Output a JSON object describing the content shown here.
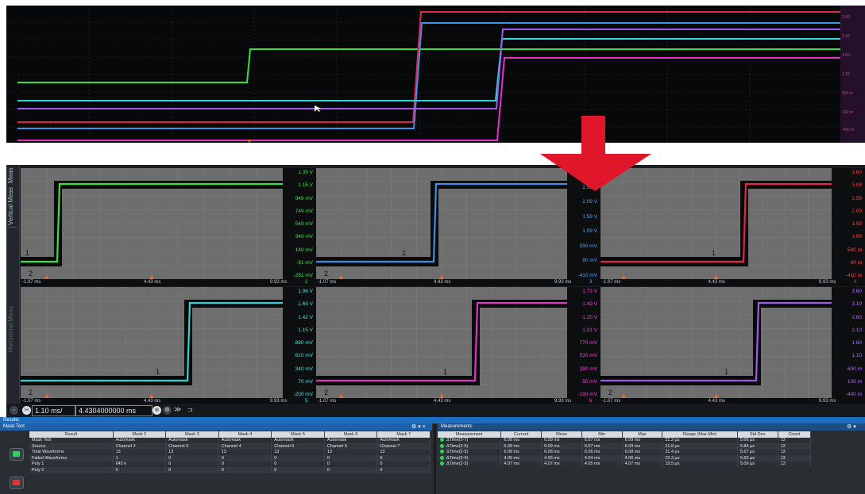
{
  "overview": {
    "scale_labels": [
      "2.60",
      "2.10",
      "1.60",
      "1.10",
      "600 m",
      "100 m",
      "-400 m"
    ]
  },
  "panels": [
    {
      "ticks": [
        "1.35 V",
        "1.15 V",
        "949 mV",
        "749 mV",
        "549 mV",
        "349 mV",
        "149 mV",
        "-51 mV",
        "-251 mV"
      ],
      "tick_color": "#3ee04a",
      "x_left": "-1.07 ms",
      "x_mid": "4.43 ms",
      "x_right": "9.93 ms",
      "channel": "2",
      "trace_color": "#37e23f",
      "marker_label": "1",
      "marker2_label": "2"
    },
    {
      "ticks": [
        "3.09 V",
        "2.59 V",
        "2.09 V",
        "1.59 V",
        "1.09 V",
        "590 mV",
        "90 mV",
        "-410 mV"
      ],
      "tick_color": "#4aa6ff",
      "x_left": "-1.07 ms",
      "x_mid": "4.43 ms",
      "x_right": "9.93 ms",
      "channel": "3",
      "trace_color": "#3e8fe8",
      "marker_label": "1",
      "marker2_label": "2"
    },
    {
      "ticks": [
        "3.60",
        "3.08",
        "2.59",
        "2.09",
        "1.59",
        "1.09",
        "590 m",
        "90 m",
        "-410 m"
      ],
      "tick_color": "#ff3a4c",
      "x_left": "-1.07 ms",
      "x_mid": "4.43 ms",
      "x_right": "9.93 ms",
      "channel": "4",
      "trace_color": "#e2264a",
      "marker_label": "1",
      "marker2_label": ""
    },
    {
      "ticks": [
        "1.96 V",
        "1.69 V",
        "1.42 V",
        "1.15 V",
        "880 mV",
        "610 mV",
        "340 mV",
        "70 mV",
        "-200 mV"
      ],
      "tick_color": "#3fe6e6",
      "x_left": "-1.07 ms",
      "x_mid": "4.43 ms",
      "x_right": "9.93 ms",
      "channel": "5",
      "trace_color": "#2ad5d8",
      "marker_label": "1",
      "marker2_label": "2"
    },
    {
      "ticks": [
        "1.73 V",
        "1.49 V",
        "1.25 V",
        "1.01 V",
        "770 mV",
        "530 mV",
        "290 mV",
        "50 mV",
        "-190 mV"
      ],
      "tick_color": "#ff3ae0",
      "x_left": "-1.07 ms",
      "x_mid": "4.43 ms",
      "x_right": "9.93 ms",
      "channel": "6",
      "trace_color": "#e233c8",
      "marker_label": "1",
      "marker2_label": "2"
    },
    {
      "ticks": [
        "3.60",
        "3.10",
        "2.60",
        "2.10",
        "1.60",
        "1.10",
        "600 m",
        "100 m",
        "-400 m"
      ],
      "tick_color": "#b26bff",
      "x_left": "-1.07 ms",
      "x_mid": "4.43 ms",
      "x_right": "9.93 ms",
      "channel": "",
      "trace_color": "#9d5bf0",
      "marker_label": "1",
      "marker2_label": "2"
    }
  ],
  "sidebar": {
    "tab1": "Meas",
    "tab2": "Vertical Meas",
    "tab3": "Horizontal Meas"
  },
  "timebar": {
    "scale": "1.10 ms/",
    "position": "4.4304000000 ms"
  },
  "results": {
    "title": "Results",
    "mask_panel": {
      "title": "Mask Test",
      "headers": [
        "Result",
        "Mask 2",
        "Mask 3",
        "Mask 4",
        "Mask 5",
        "Mask 6",
        "Mask 7"
      ],
      "rows": [
        [
          "Mask Test",
          "Automask",
          "Automask",
          "Automask",
          "Automask",
          "Automask",
          "Automask"
        ],
        [
          "Source",
          "Channel 2",
          "Channel 3",
          "Channel 4",
          "Channel 5",
          "Channel 6",
          "Channel 7"
        ],
        [
          "Total Waveforms",
          "13",
          "13",
          "13",
          "13",
          "13",
          "13"
        ],
        [
          "Failed Waveforms",
          "1",
          "0",
          "0",
          "0",
          "0",
          "0"
        ],
        [
          "Poly 1",
          "645 k",
          "0",
          "0",
          "0",
          "0",
          "0"
        ],
        [
          "Poly 2",
          "0",
          "0",
          "0",
          "0",
          "0",
          "0"
        ]
      ]
    },
    "meas_panel": {
      "title": "Measurements",
      "headers": [
        "Measurement",
        "Current",
        "Mean",
        "Min",
        "Max",
        "Range (Max-Min)",
        "Std Dev",
        "Count"
      ],
      "rows": [
        [
          "ΔTime(2-7)",
          "6.09 ms",
          "6.09 ms",
          "6.07 ms",
          "6.09 ms",
          "21.2 µs",
          "5.66 µs",
          "13"
        ],
        [
          "ΔTime(2-6)",
          "6.09 ms",
          "6.09 ms",
          "6.07 ms",
          "6.09 ms",
          "21.8 µs",
          "5.84 µs",
          "13"
        ],
        [
          "ΔTime(2-5)",
          "6.08 ms",
          "6.08 ms",
          "6.06 ms",
          "6.08 ms",
          "21.4 µs",
          "5.67 µs",
          "13"
        ],
        [
          "ΔTime(2-4)",
          "4.06 ms",
          "4.06 ms",
          "4.04 ms",
          "4.06 ms",
          "22.3 µs",
          "5.65 µs",
          "13"
        ],
        [
          "ΔTime(2-3)",
          "4.07 ms",
          "4.07 ms",
          "4.05 ms",
          "4.07 ms",
          "19.5 µs",
          "5.09 µs",
          "13"
        ]
      ]
    }
  },
  "colors": {
    "arrow": "#e0162b",
    "accent": "#1b6ec2"
  }
}
